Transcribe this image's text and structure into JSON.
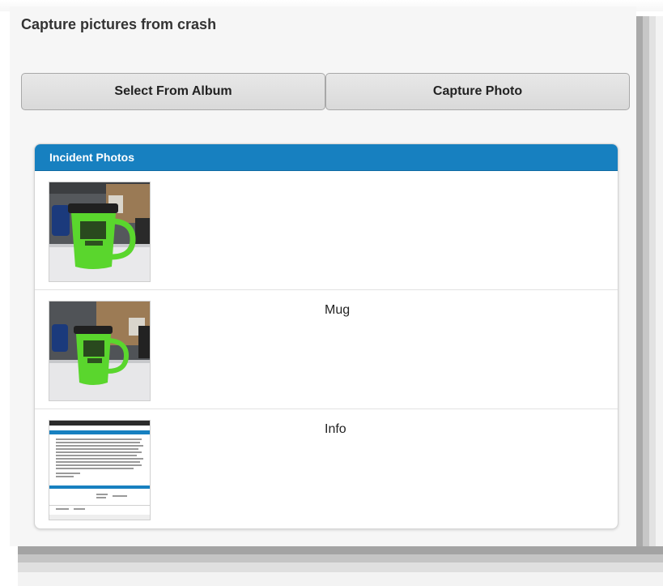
{
  "page": {
    "title": "Capture pictures from crash"
  },
  "buttons": {
    "select_album": "Select From Album",
    "capture_photo": "Capture Photo"
  },
  "incident_photos": {
    "header": "Incident Photos",
    "items": [
      {
        "caption": "",
        "image": "green-mug-photo"
      },
      {
        "caption": "Mug",
        "image": "green-mug-photo"
      },
      {
        "caption": "Info",
        "image": "document-screenshot"
      }
    ]
  },
  "colors": {
    "header_blue": "#1780c0",
    "mug_green": "#5ad62d",
    "page_bg": "#f6f6f6"
  }
}
